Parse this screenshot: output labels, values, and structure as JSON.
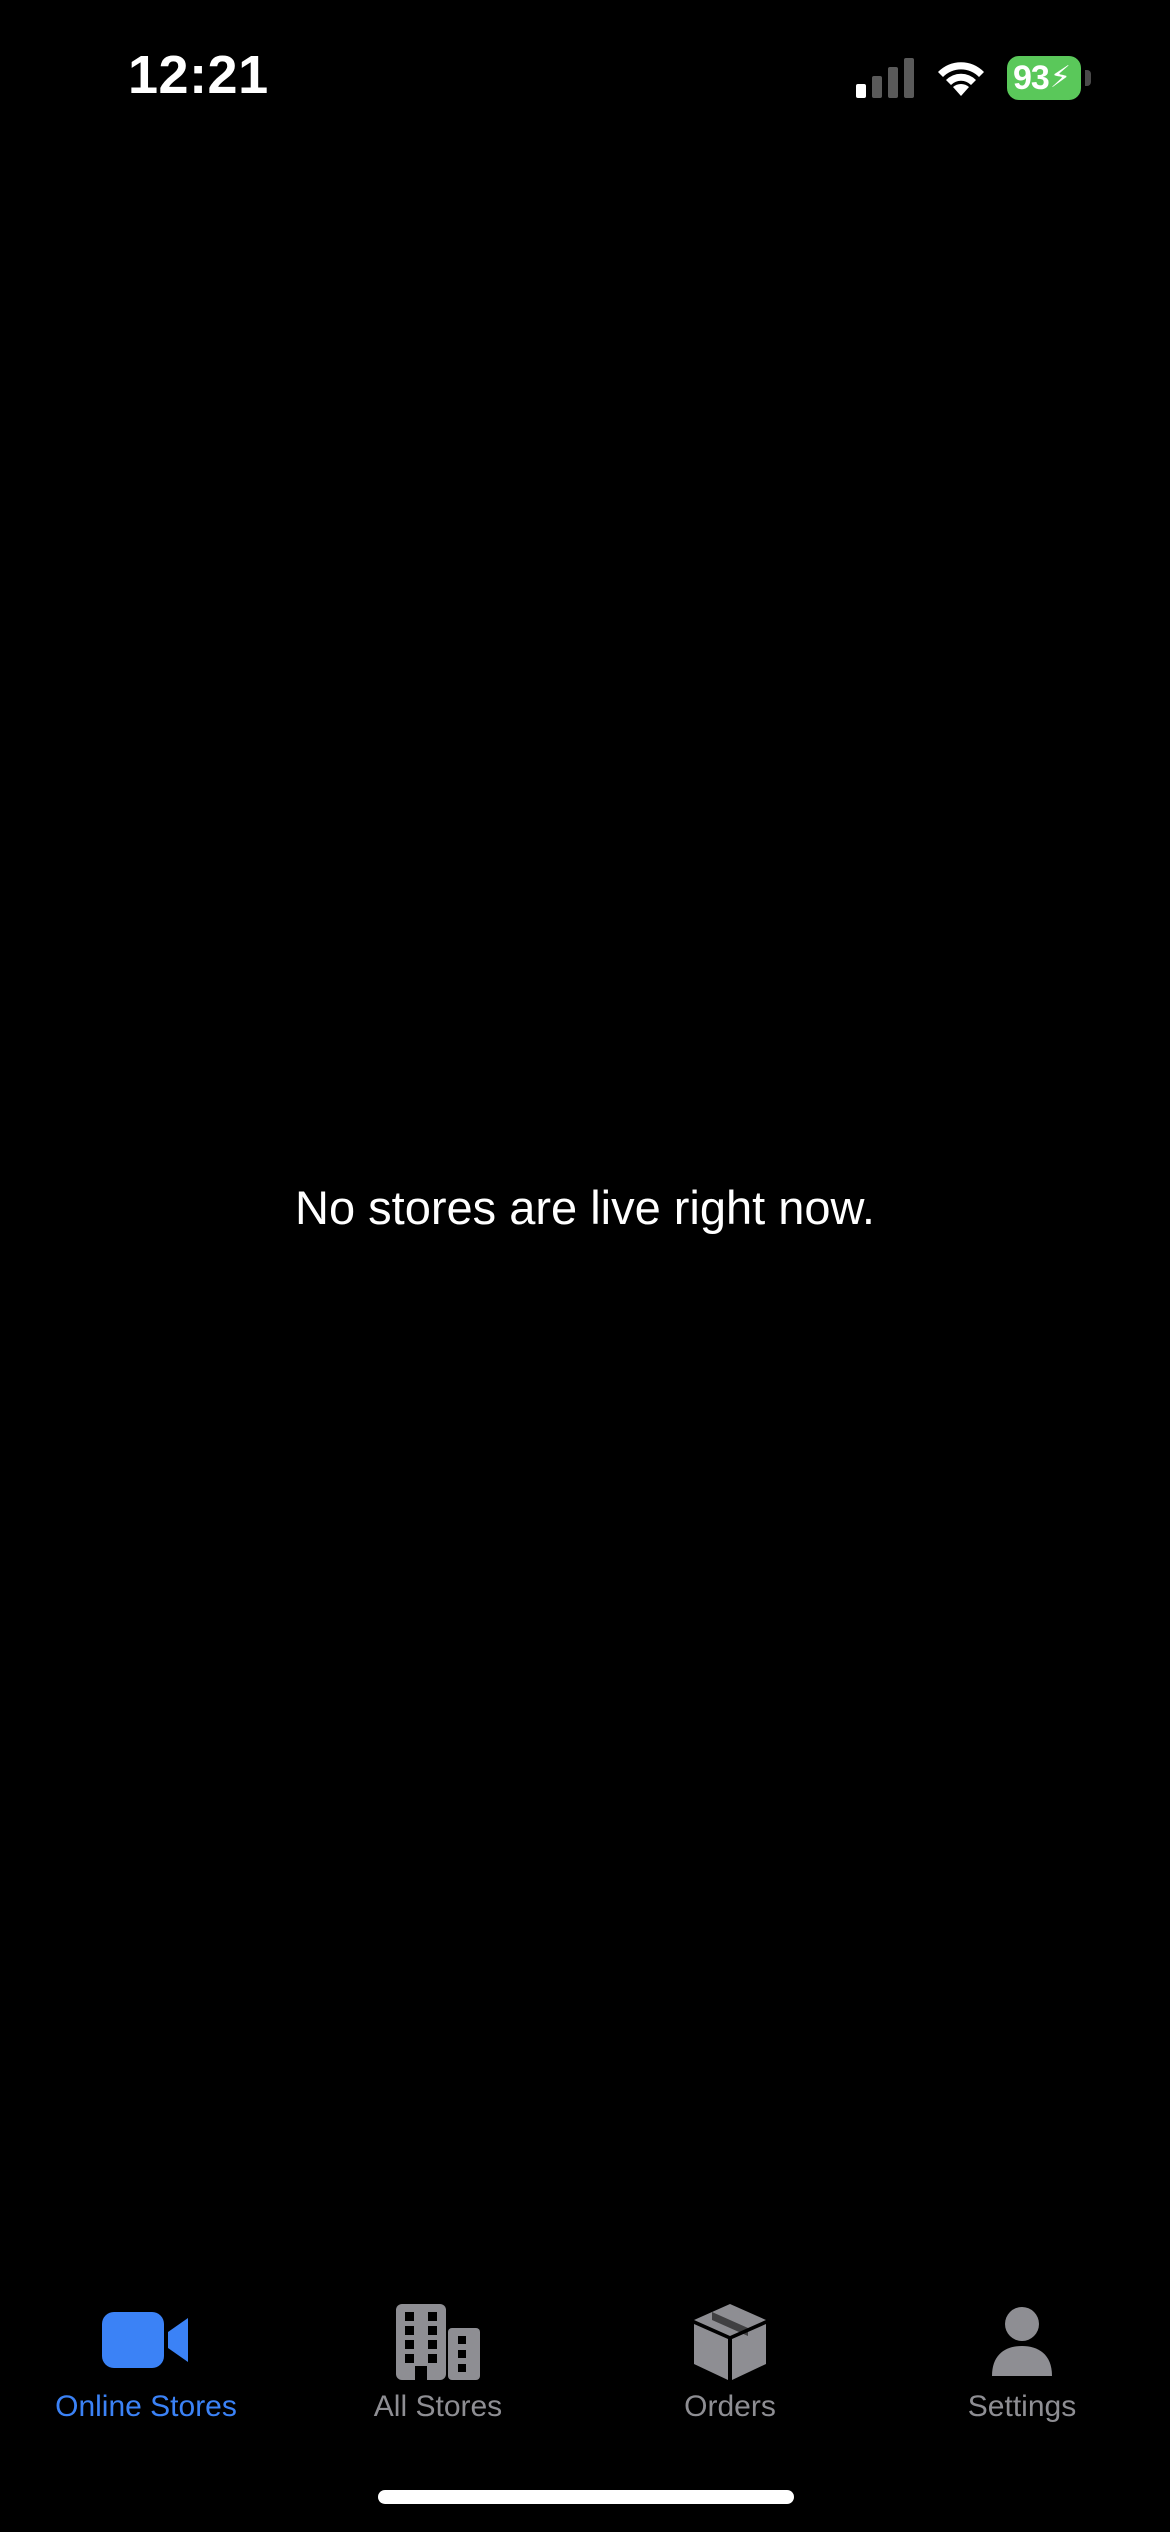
{
  "status_bar": {
    "time": "12:21",
    "battery_level": "93",
    "battery_charging": true,
    "battery_color": "#5ac85a",
    "signal_bars_active": 1,
    "signal_bars_total": 4
  },
  "main": {
    "empty_message": "No stores are live right now."
  },
  "tab_bar": {
    "active_color": "#3b82f6",
    "inactive_color": "#8e8e93",
    "tabs": [
      {
        "label": "Online Stores",
        "icon": "video-camera-icon",
        "active": true
      },
      {
        "label": "All Stores",
        "icon": "building-icon",
        "active": false
      },
      {
        "label": "Orders",
        "icon": "package-box-icon",
        "active": false
      },
      {
        "label": "Settings",
        "icon": "person-icon",
        "active": false
      }
    ]
  }
}
